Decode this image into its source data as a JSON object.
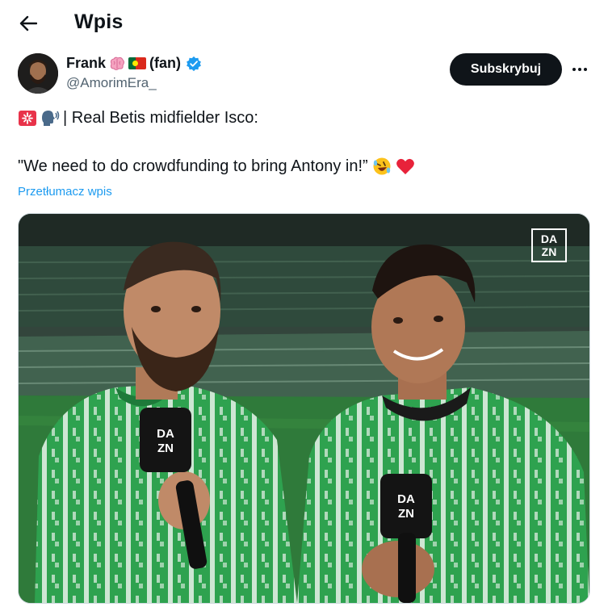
{
  "header": {
    "title": "Wpis"
  },
  "author": {
    "name": "Frank",
    "name_suffix": "(fan)",
    "handle": "@AmorimEra_",
    "name_emojis": [
      "brain",
      "portugal-flag"
    ]
  },
  "actions": {
    "subscribe_label": "Subskrybuj"
  },
  "tweet": {
    "line1": "| Real Betis midfielder Isco:",
    "line2": "\"We need to do crowdfunding to bring Antony in!”",
    "line1_emojis": [
      "rotating-light",
      "speaking-head"
    ],
    "line2_emojis": [
      "rolling-on-floor-laughing",
      "red-heart"
    ],
    "translate_label": "Przetłumacz wpis"
  },
  "media": {
    "watermark_top": "DA",
    "watermark_bottom": "ZN"
  },
  "colors": {
    "accent": "#1d9bf0",
    "text": "#0f1419",
    "secondary_text": "#536471",
    "button_bg": "#0f1419",
    "jersey_green": "#2e9e50"
  }
}
